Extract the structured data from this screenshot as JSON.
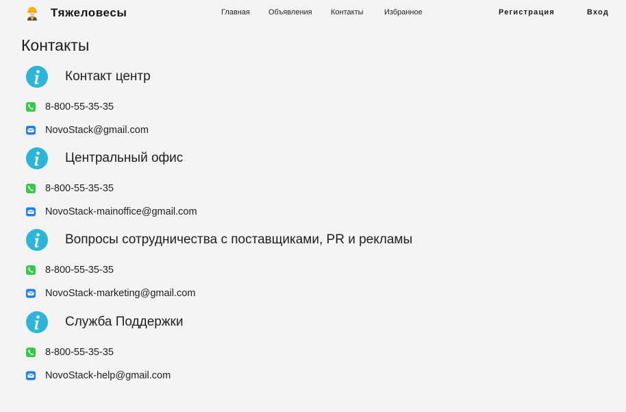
{
  "header": {
    "brand_name": "Тяжеловесы",
    "nav": [
      {
        "label": "Главная"
      },
      {
        "label": "Объявления"
      },
      {
        "label": "Контакты"
      },
      {
        "label": "Избранное"
      }
    ],
    "auth": {
      "register_label": "Регистрация",
      "login_label": "Вход"
    }
  },
  "page": {
    "title": "Контакты"
  },
  "sections": [
    {
      "title": "Контакт центр",
      "phone": "8-800-55-35-35",
      "email": "NovoStack@gmail.com"
    },
    {
      "title": "Центральный офис",
      "phone": "8-800-55-35-35",
      "email": "NovoStack-mainoffice@gmail.com"
    },
    {
      "title": "Вопросы сотрудничества с поставщиками, PR и рекламы",
      "phone": "8-800-55-35-35",
      "email": "NovoStack-marketing@gmail.com"
    },
    {
      "title": "Служба Поддержки",
      "phone": "8-800-55-35-35",
      "email": "NovoStack-help@gmail.com"
    }
  ],
  "icons": {
    "logo": "construction-worker-icon",
    "info": "info-icon",
    "phone": "phone-icon",
    "email": "email-icon"
  },
  "colors": {
    "info_blue": "#2bb5d8",
    "phone_green": "#37c948",
    "mail_blue": "#1a7ff0",
    "background": "#f3f3f3"
  }
}
